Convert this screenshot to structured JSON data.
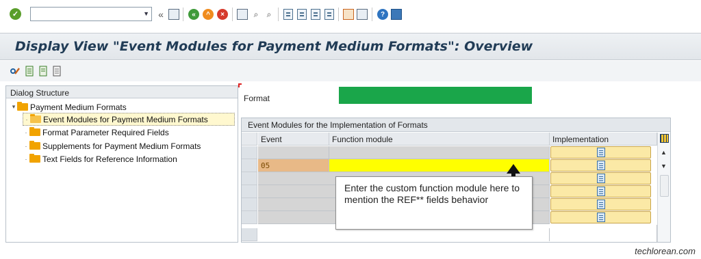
{
  "toolbar": {
    "command_field_value": "",
    "icons": [
      "check-icon",
      "back-icon",
      "save-icon",
      "back-green-icon",
      "exit-icon",
      "cancel-icon",
      "print-icon",
      "find-icon",
      "find-next-icon",
      "first-page-icon",
      "previous-page-icon",
      "next-page-icon",
      "last-page-icon",
      "create-session-icon",
      "shortcut-icon",
      "help-icon",
      "customize-layout-icon"
    ]
  },
  "title": "Display View \"Event Modules for Payment Medium Formats\": Overview",
  "app_toolbar": {
    "icons": [
      "display-change-icon",
      "select-all-icon",
      "select-block-icon",
      "deselect-all-icon"
    ]
  },
  "dialog_structure": {
    "header": "Dialog Structure",
    "items": [
      {
        "label": "Payment Medium Formats",
        "level": 0
      },
      {
        "label": "Event Modules for Payment Medium Formats",
        "level": 1,
        "selected": true
      },
      {
        "label": "Format Parameter Required Fields",
        "level": 1
      },
      {
        "label": "Supplements for Payment Medium Formats",
        "level": 1
      },
      {
        "label": "Text Fields for Reference Information",
        "level": 1
      }
    ]
  },
  "format": {
    "label": "Format",
    "value": ""
  },
  "table": {
    "caption": "Event Modules for the Implementation of Formats",
    "columns": [
      "Event",
      "Function module",
      "Implementation"
    ],
    "rows": [
      {
        "event": "",
        "function_module": ""
      },
      {
        "event": "05",
        "function_module": ""
      }
    ]
  },
  "annotation": {
    "text": "Enter the custom function module here to mention the REF** fields behavior"
  },
  "watermark": "techlorean.com",
  "colors": {
    "format_field": "#1aa64a",
    "highlight_field": "#ffff00",
    "title": "#213c56"
  }
}
